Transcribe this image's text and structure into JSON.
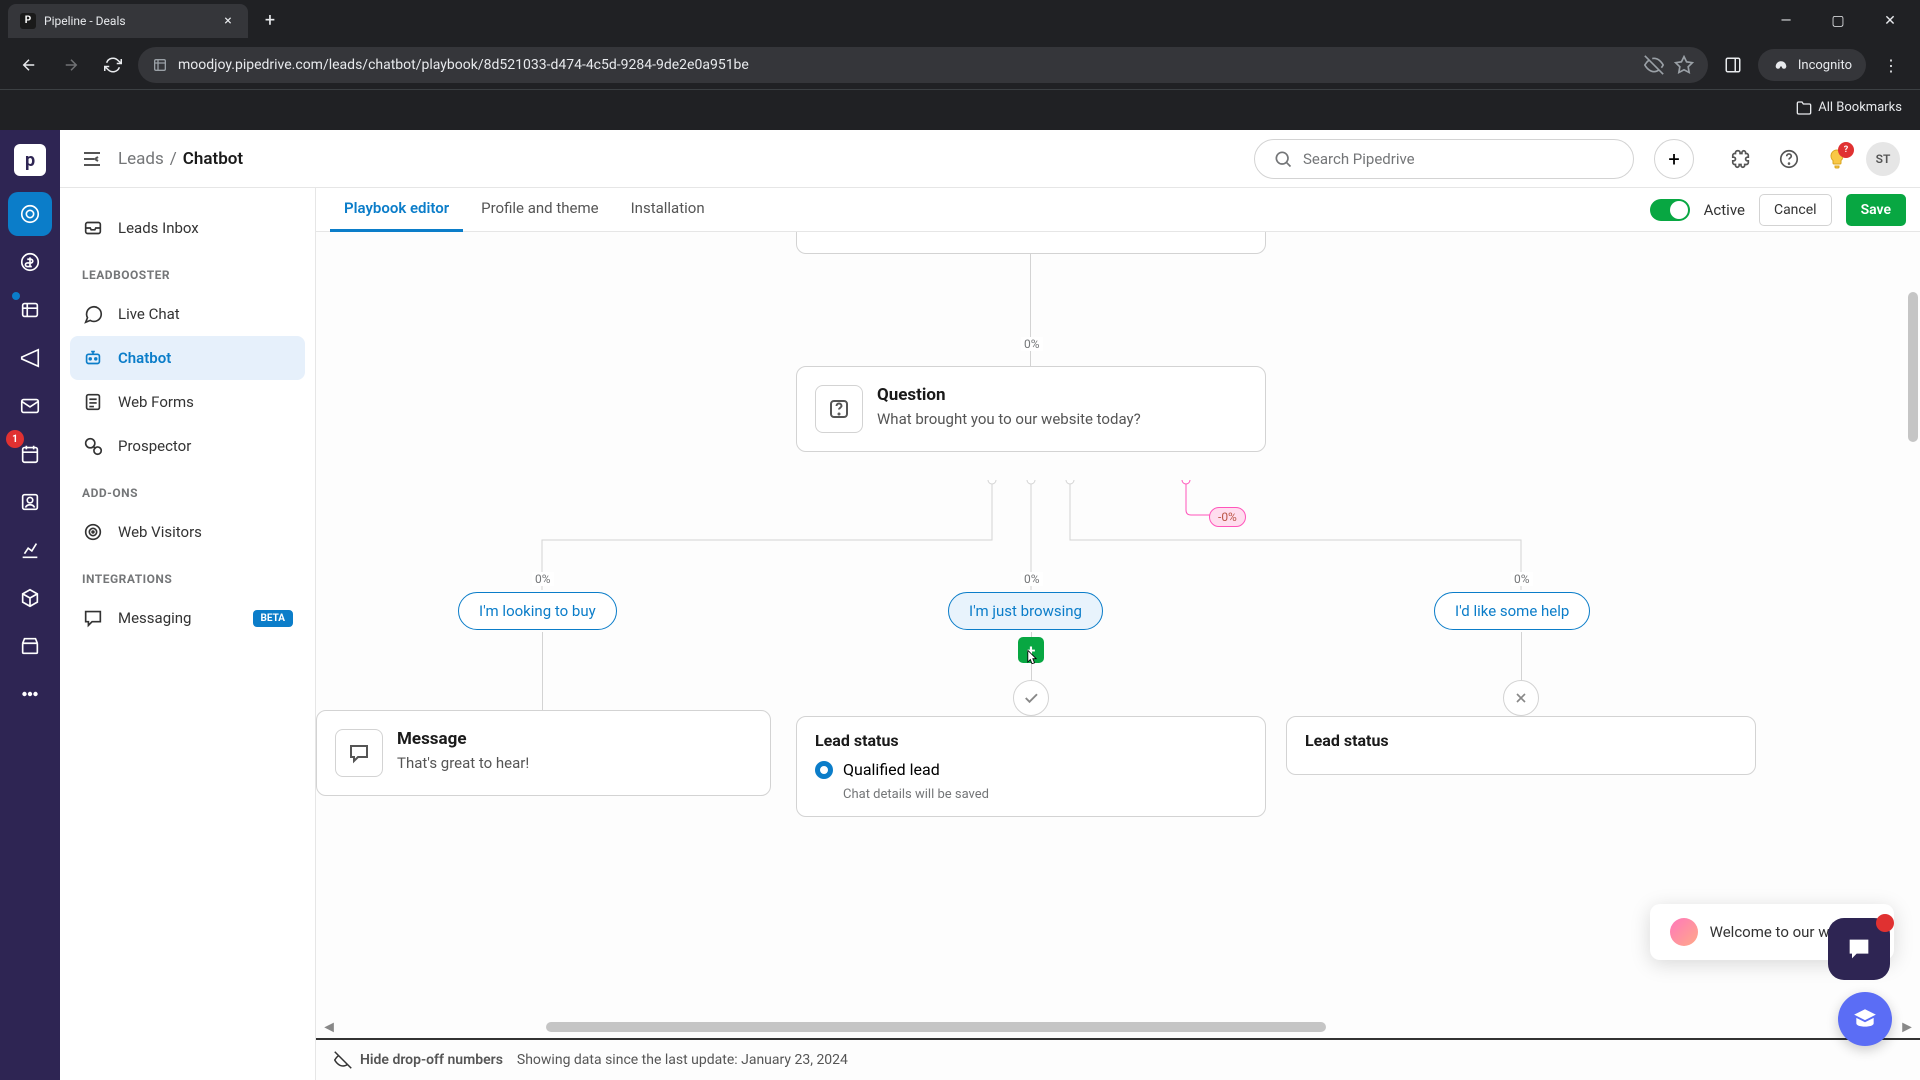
{
  "browser": {
    "tab_title": "Pipeline - Deals",
    "url": "moodjoy.pipedrive.com/leads/chatbot/playbook/8d521033-d474-4c5d-9284-9de2e0a951be",
    "incognito_label": "Incognito",
    "all_bookmarks": "All Bookmarks"
  },
  "breadcrumb": {
    "parent": "Leads",
    "sep": "/",
    "current": "Chatbot"
  },
  "search_placeholder": "Search Pipedrive",
  "avatar_initials": "ST",
  "bulb_badge": "?",
  "sidebar": {
    "inbox": "Leads Inbox",
    "section_leadbooster": "LEADBOOSTER",
    "live_chat": "Live Chat",
    "chatbot": "Chatbot",
    "web_forms": "Web Forms",
    "prospector": "Prospector",
    "section_addons": "ADD-ONS",
    "web_visitors": "Web Visitors",
    "section_integrations": "INTEGRATIONS",
    "messaging": "Messaging",
    "beta": "BETA"
  },
  "tabs": {
    "editor": "Playbook editor",
    "profile": "Profile and theme",
    "installation": "Installation",
    "active": "Active",
    "cancel": "Cancel",
    "save": "Save"
  },
  "flow": {
    "pct_top": "0%",
    "question_title": "Question",
    "question_text": "What brought you to our website today?",
    "pct_branch": "-0%",
    "pct_a": "0%",
    "choice_a": "I'm looking to buy",
    "pct_b": "0%",
    "choice_b": "I'm just browsing",
    "pct_c": "0%",
    "choice_c": "I'd like some help",
    "message_title": "Message",
    "message_text": "That's great to hear!",
    "lead_status_title": "Lead status",
    "qualified_lead": "Qualified lead",
    "chat_saved": "Chat details will be saved"
  },
  "footer": {
    "hide_link": "Hide drop-off numbers",
    "info": "Showing data since the last update: January 23, 2024"
  },
  "chat_toast": "Welcome to our website!",
  "rail_badge_count": "1"
}
